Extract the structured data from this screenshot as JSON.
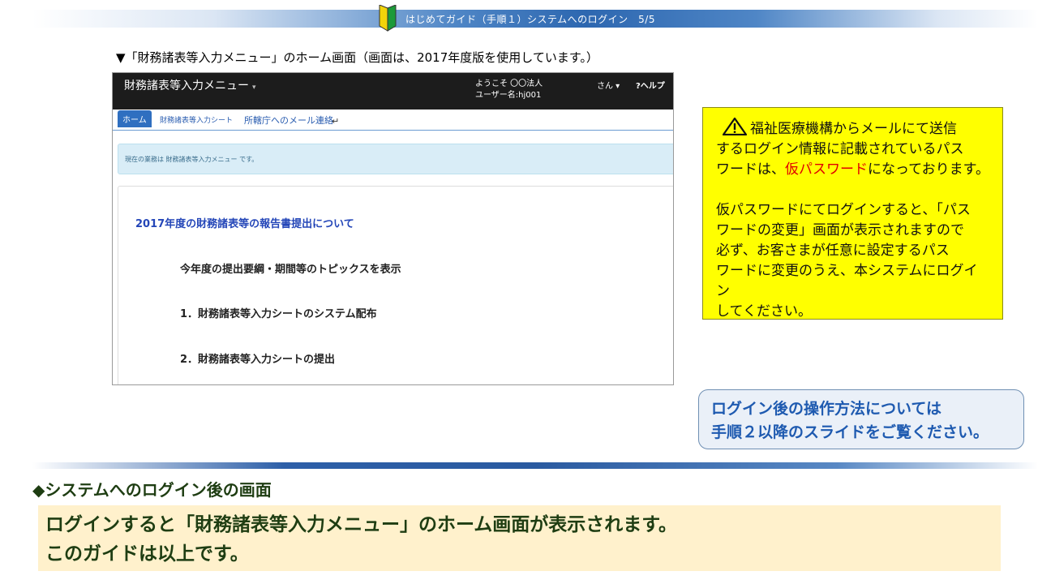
{
  "header": {
    "title": "はじめてガイド（手順１）システムへのログイン　5/5"
  },
  "caption": "▼「財務諸表等入力メニュー」のホーム画面（画面は、2017年度版を使用しています。）",
  "app": {
    "title": "財務諸表等入力メニュー",
    "title_caret": "▾",
    "welcome_line1": "ようこそ 〇〇法人",
    "welcome_line2": "ユーザー名:hj001",
    "user_suffix": "さん ▾",
    "help": "?ヘルプ",
    "tabs": [
      {
        "label": "ホーム"
      },
      {
        "label": "財務諸表等入力シート"
      },
      {
        "label": "所轄庁へのメール連絡"
      }
    ],
    "enter_glyph": "↵",
    "info_text": "現在の業務は 財務諸表等入力メニュー です。",
    "content": {
      "heading": "2017年度の財務諸表等の報告書提出について",
      "lines": [
        "今年度の提出要綱・期間等のトピックスを表示",
        "1．財務諸表等入力シートのシステム配布",
        "2．財務諸表等入力シートの提出"
      ]
    }
  },
  "warning": {
    "icon": "warning-triangle-icon",
    "para1_a": "福祉医療機構からメールにて送信",
    "para1_b": "するログイン情報に記載されているパス",
    "para1_c_pre": "ワードは、",
    "para1_c_red": "仮パスワード",
    "para1_c_post": "になっております。",
    "para2_lines": [
      "仮パスワードにてログインすると、「パス",
      "ワードの変更」画面が表示されますので",
      "必ず、お客さまが任意に設定するパス",
      "ワードに変更のうえ、本システムにログイン",
      "してください。"
    ],
    "highlight_color": "#e00000",
    "background_color": "#ffff00"
  },
  "next_steps": {
    "line1": "ログイン後の操作方法については",
    "line2": "手順２以降のスライドをご覧ください。"
  },
  "section": {
    "title": "◆システムへのログイン後の画面"
  },
  "summary": {
    "line1": "ログインすると「財務諸表等入力メニュー」のホーム画面が表示されます。",
    "line2": "このガイドは以上です。"
  },
  "colors": {
    "accent_blue": "#2d67b0",
    "section_text": "#1e3d12",
    "summary_bg": "#fff1cc"
  }
}
